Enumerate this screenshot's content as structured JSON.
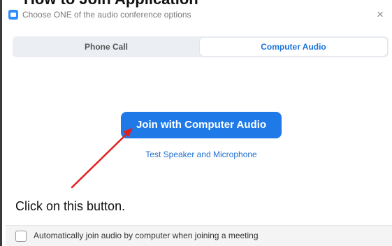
{
  "caption": {
    "top_text": "How to Join Application"
  },
  "dialog": {
    "title": "Choose ONE of the audio conference options",
    "close_symbol": "×",
    "tabs": [
      {
        "label": "Phone Call",
        "active": false
      },
      {
        "label": "Computer Audio",
        "active": true
      }
    ],
    "join_button_label": "Join with Computer Audio",
    "test_link_label": "Test Speaker and Microphone",
    "auto_join_label": "Automatically join audio by computer when joining a meeting",
    "auto_join_checked": false
  },
  "annotation": {
    "text": "Click on this button.",
    "arrow_color": "#e0201e"
  },
  "colors": {
    "accent": "#1f7ae8",
    "tab_active_text": "#1a73d9",
    "link": "#1f6fd0"
  },
  "icons": {
    "app_icon": "zoom-camera-icon",
    "close_icon": "close-icon",
    "arrow": "red-pointer-arrow"
  }
}
